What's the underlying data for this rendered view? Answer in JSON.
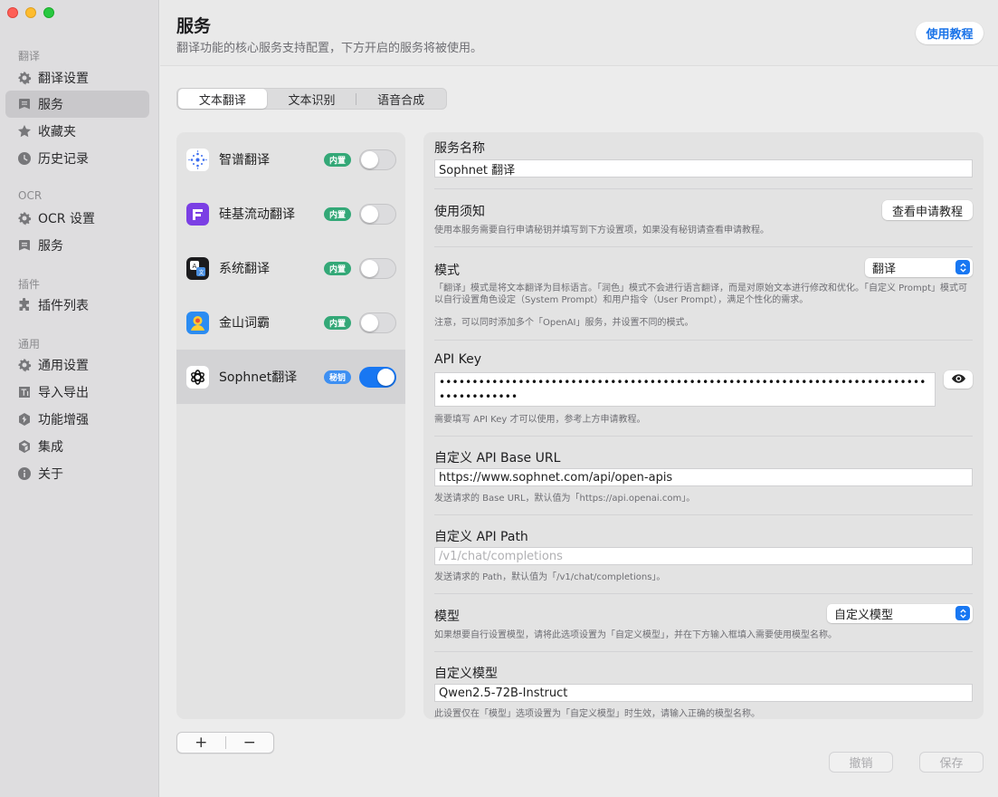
{
  "sidebar": {
    "groups": {
      "translate": "翻译",
      "ocr": "OCR",
      "plugins": "插件",
      "general": "通用"
    },
    "items": [
      {
        "label": "翻译设置",
        "icon": "gear-icon"
      },
      {
        "label": "服务",
        "icon": "service-icon"
      },
      {
        "label": "收藏夹",
        "icon": "star-icon"
      },
      {
        "label": "历史记录",
        "icon": "clock-icon"
      },
      {
        "label": "OCR 设置",
        "icon": "gear-icon"
      },
      {
        "label": "服务",
        "icon": "service-icon"
      },
      {
        "label": "插件列表",
        "icon": "puzzle-icon"
      },
      {
        "label": "通用设置",
        "icon": "gear-icon"
      },
      {
        "label": "导入导出",
        "icon": "import-export-icon"
      },
      {
        "label": "功能增强",
        "icon": "enhance-icon"
      },
      {
        "label": "集成",
        "icon": "integration-icon"
      },
      {
        "label": "关于",
        "icon": "info-icon"
      }
    ]
  },
  "header": {
    "title": "服务",
    "subtitle": "翻译功能的核心服务支持配置，下方开启的服务将被使用。",
    "help_label": "使用教程"
  },
  "tabs": [
    {
      "label": "文本翻译",
      "active": true
    },
    {
      "label": "文本识别",
      "active": false
    },
    {
      "label": "语音合成",
      "active": false
    }
  ],
  "services": [
    {
      "name": "智谱翻译",
      "badge": "内置",
      "enabled": false,
      "icon": "zhipu-logo-icon"
    },
    {
      "name": "硅基流动翻译",
      "badge": "内置",
      "enabled": false,
      "icon": "siliconflow-logo-icon"
    },
    {
      "name": "系统翻译",
      "badge": "内置",
      "enabled": false,
      "icon": "system-translate-logo-icon"
    },
    {
      "name": "金山词霸",
      "badge": "内置",
      "enabled": false,
      "icon": "iciba-logo-icon"
    },
    {
      "name": "Sophnet翻译",
      "badge": "秘钥",
      "enabled": true,
      "icon": "openai-logo-icon"
    }
  ],
  "list_controls": {
    "add": "+",
    "remove": "−"
  },
  "detail": {
    "service_name_label": "服务名称",
    "service_name_value": "Sophnet 翻译",
    "notice_label": "使用须知",
    "notice_button": "查看申请教程",
    "notice_desc": "使用本服务需要自行申请秘钥并填写到下方设置项，如果没有秘钥请查看申请教程。",
    "mode_label": "模式",
    "mode_value": "翻译",
    "mode_desc": "「翻译」模式是将文本翻译为目标语言。「润色」模式不会进行语言翻译，而是对原始文本进行修改和优化。「自定义 Prompt」模式可以自行设置角色设定（System Prompt）和用户指令（User Prompt），满足个性化的需求。",
    "mode_note": "注意，可以同时添加多个「OpenAI」服务，并设置不同的模式。",
    "api_key_label": "API Key",
    "api_key_value": "••••••••••••••••••••••••••••••••••••••••••••••••••••••••••••••••••••••••••••••••••••••",
    "api_key_desc": "需要填写 API Key 才可以使用，参考上方申请教程。",
    "base_url_label": "自定义 API Base URL",
    "base_url_value": "https://www.sophnet.com/api/open-apis",
    "base_url_desc": "发送请求的 Base URL，默认值为「https://api.openai.com」。",
    "api_path_label": "自定义 API Path",
    "api_path_placeholder": "/v1/chat/completions",
    "api_path_desc": "发送请求的 Path，默认值为「/v1/chat/completions」。",
    "model_label": "模型",
    "model_value": "自定义模型",
    "model_desc": "如果想要自行设置模型，请将此选项设置为「自定义模型」，并在下方输入框填入需要使用模型名称。",
    "custom_model_label": "自定义模型",
    "custom_model_value": "Qwen2.5-72B-Instruct",
    "custom_model_desc": "此设置仅在「模型」选项设置为「自定义模型」时生效，请输入正确的模型名称。"
  },
  "footer": {
    "cancel": "撤销",
    "save": "保存"
  }
}
